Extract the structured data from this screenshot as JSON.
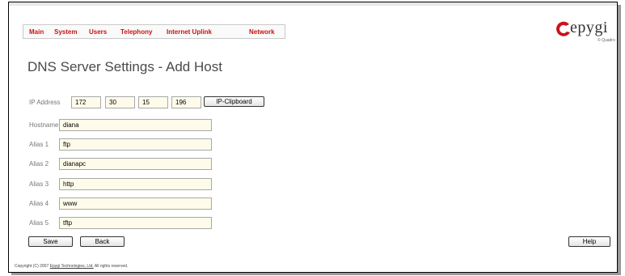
{
  "nav": {
    "items": [
      "Main",
      "System",
      "Users",
      "Telephony",
      "Internet Uplink",
      "Network"
    ]
  },
  "logo": {
    "text": "epygi",
    "sub": "© Quadro"
  },
  "page": {
    "title": "DNS Server Settings - Add Host"
  },
  "form": {
    "ip_label": "IP Address",
    "ip_octets": [
      "172",
      "30",
      "15",
      "196"
    ],
    "clipboard_label": "IP-Clipboard",
    "hostname_label": "Hostname",
    "hostname_value": "diana",
    "aliases": [
      {
        "label": "Alias 1",
        "value": "ftp"
      },
      {
        "label": "Alias 2",
        "value": "dianapc"
      },
      {
        "label": "Alias 3",
        "value": "http"
      },
      {
        "label": "Alias 4",
        "value": "www"
      },
      {
        "label": "Alias 5",
        "value": "tftp"
      }
    ]
  },
  "buttons": {
    "save": "Save",
    "back": "Back",
    "help": "Help"
  },
  "footer": {
    "prefix": "Copyright (C) 2007",
    "company": "Epygi Technologies, Ltd.",
    "suffix": "All rights reserved."
  },
  "colors": {
    "nav_text": "#cc1010",
    "field_bg": "#fffbea",
    "logo_red": "#c8141e"
  }
}
